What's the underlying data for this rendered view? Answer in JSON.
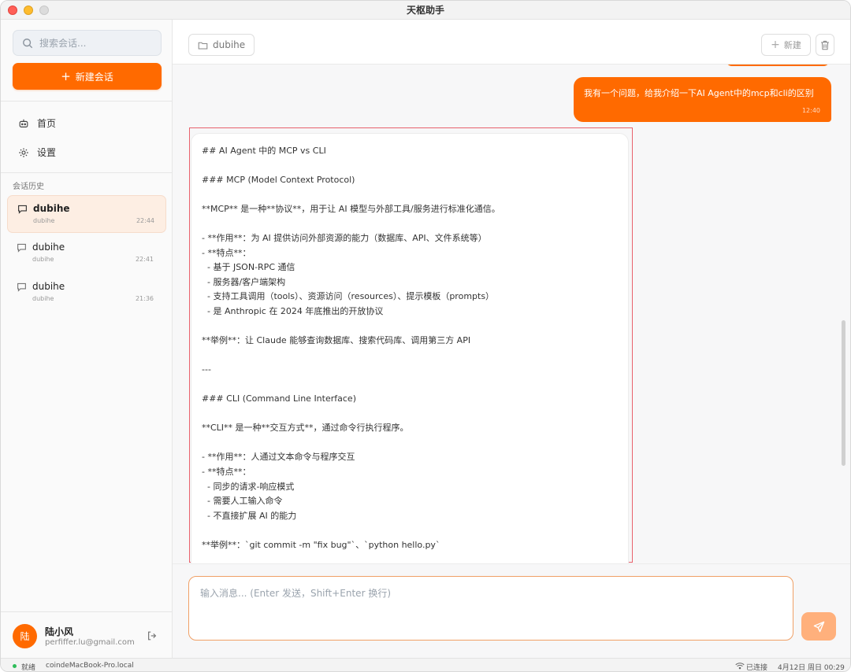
{
  "window": {
    "title": "天枢助手"
  },
  "sidebar": {
    "search_placeholder": "搜索会话...",
    "new_chat_label": "新建会话",
    "nav": [
      {
        "label": "首页",
        "icon": "robot-icon"
      },
      {
        "label": "设置",
        "icon": "gear-icon"
      }
    ],
    "history_label": "会话历史",
    "conversations": [
      {
        "name": "dubihe",
        "sub": "dubihe",
        "time": "22:44",
        "active": true
      },
      {
        "name": "dubihe",
        "sub": "dubihe",
        "time": "22:41",
        "active": false
      },
      {
        "name": "dubihe",
        "sub": "dubihe",
        "time": "21:36",
        "active": false
      }
    ],
    "user": {
      "avatar_text": "陆",
      "name": "陆小风",
      "email": "perfiffer.lu@gmail.com"
    }
  },
  "header": {
    "folder_label": "dubihe",
    "new_label": "新建"
  },
  "chat": {
    "user_message": {
      "text": "我有一个问题，给我介绍一下AI Agent中的mcp和cli的区别",
      "time": "12:40"
    },
    "ai_lines": [
      "## AI Agent 中的 MCP vs CLI",
      "",
      "### MCP (Model Context Protocol)",
      "",
      "**MCP** 是一种**协议**，用于让 AI 模型与外部工具/服务进行标准化通信。",
      "",
      "- **作用**：为 AI 提供访问外部资源的能力（数据库、API、文件系统等）",
      "- **特点**：",
      "  - 基于 JSON-RPC 通信",
      "  - 服务器/客户端架构",
      "  - 支持工具调用（tools）、资源访问（resources）、提示模板（prompts）",
      "  - 是 Anthropic 在 2024 年底推出的开放协议",
      "",
      "**举例**：让 Claude 能够查询数据库、搜索代码库、调用第三方 API",
      "",
      "---",
      "",
      "### CLI (Command Line Interface)",
      "",
      "**CLI** 是一种**交互方式**，通过命令行执行程序。",
      "",
      "- **作用**：人通过文本命令与程序交互",
      "- **特点**：",
      "  - 同步的请求-响应模式",
      "  - 需要人工输入命令",
      "  - 不直接扩展 AI 的能力",
      "",
      "**举例**：`git commit -m \"fix bug\"`、`python hello.py`"
    ]
  },
  "input": {
    "placeholder": "输入消息... (Enter 发送，Shift+Enter 换行)"
  },
  "statusbar": {
    "status": "就绪",
    "host": "coindeMacBook-Pro.local",
    "connection": "已连接",
    "datetime": "4月12日 周日 00:29"
  },
  "colors": {
    "accent": "#ff6a00",
    "accent_light": "#ffb07c",
    "active_conv_bg": "#fdeee3",
    "status_ok": "#2ebd59"
  }
}
